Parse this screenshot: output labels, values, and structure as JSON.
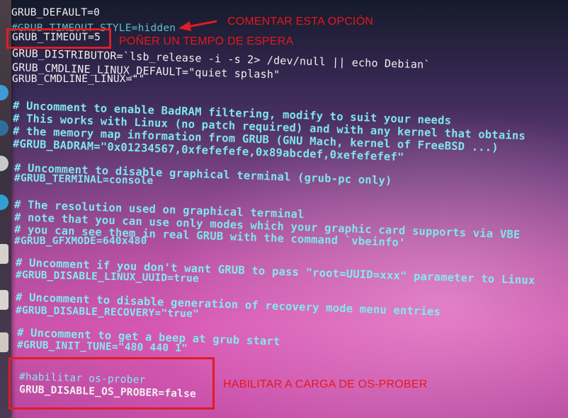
{
  "config_lines": {
    "default": "GRUB_DEFAULT=0",
    "timeout_style": "#GRUB_TIMEOUT_STYLE=hidden",
    "timeout": "GRUB_TIMEOUT=5",
    "distributor": "GRUB_DISTRIBUTOR=`lsb_release -i -s 2> /dev/null || echo Debian`",
    "cmdline_default": "GRUB_CMDLINE_LINUX_DEFAULT=\"quiet splash\"",
    "cmdline": "GRUB_CMDLINE_LINUX=\"\""
  },
  "badram_block": [
    "# Uncomment to enable BadRAM filtering, modify to suit your needs",
    "# This works with Linux (no patch required) and with any kernel that obtains",
    "# the memory map information from GRUB (GNU Mach, kernel of FreeBSD ...)",
    "#GRUB_BADRAM=\"0x01234567,0xfefefefe,0x89abcdef,0xefefefef\""
  ],
  "terminal_block": [
    "# Uncomment to disable graphical terminal (grub-pc only)",
    "#GRUB_TERMINAL=console"
  ],
  "gfx_block": [
    "# The resolution used on graphical terminal",
    "# note that you can use only modes which your graphic card supports via VBE",
    "# you can see them in real GRUB with the command `vbeinfo'",
    "#GRUB_GFXMODE=640x480"
  ],
  "uuid_block": [
    "# Uncomment if you don't want GRUB to pass \"root=UUID=xxx\" parameter to Linux",
    "#GRUB_DISABLE_LINUX_UUID=true"
  ],
  "recovery_block": [
    "# Uncomment to disable generation of recovery mode menu entries",
    "#GRUB_DISABLE_RECOVERY=\"true\""
  ],
  "tune_block": [
    "# Uncomment to get a beep at grub start",
    "#GRUB_INIT_TUNE=\"480 440 1\""
  ],
  "prober_block": [
    "#habilitar os-prober",
    "GRUB_DISABLE_OS_PROBER=false"
  ],
  "annotations": {
    "comment_option": "COMENTAR ESTA OPCIÓN",
    "set_timeout": "POÑER UN TEMPO DE ESPERA",
    "enable_prober": "HABILITAR A CARGA DE OS-PROBER"
  },
  "colors": {
    "annotation_red": "#e8171b",
    "text_white": "#f2f0f0",
    "comment_cyan": "#7fe6e9"
  }
}
